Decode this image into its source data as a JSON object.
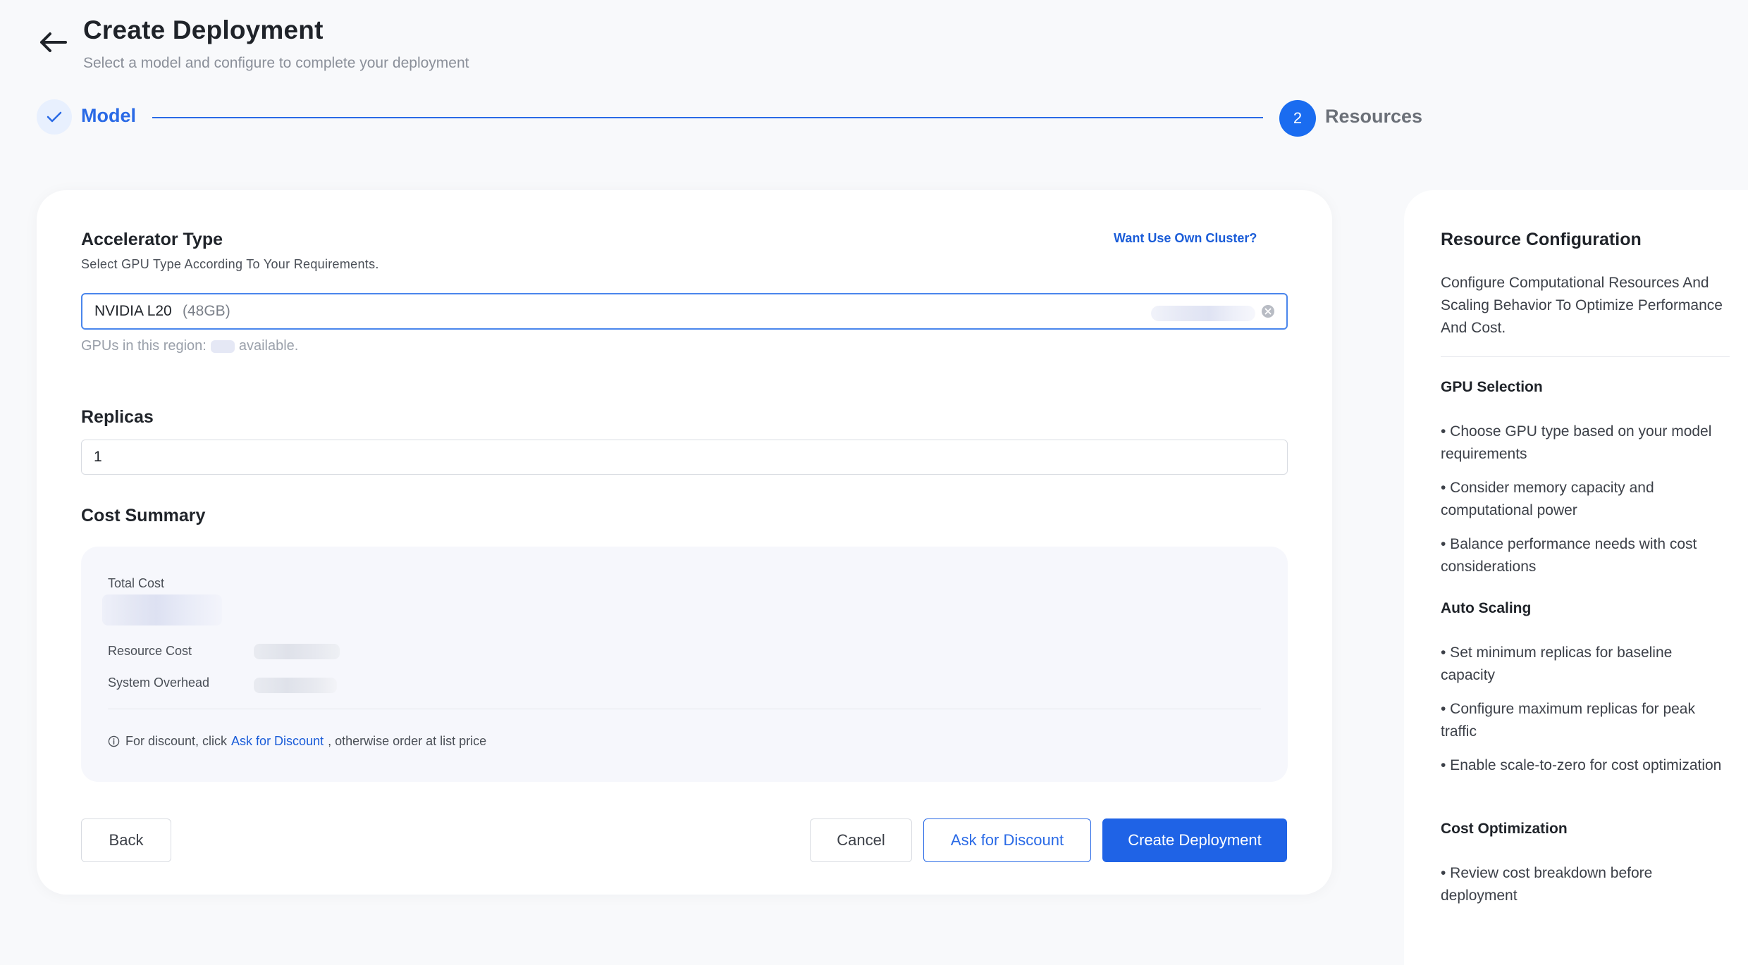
{
  "header": {
    "title": "Create Deployment",
    "subtitle": "Select a model and configure to complete your deployment"
  },
  "stepper": {
    "step1_label": "Model",
    "step2_number": "2",
    "step2_label": "Resources"
  },
  "accelerator": {
    "title": "Accelerator Type",
    "description": "Select GPU Type According To Your Requirements.",
    "own_cluster_link": "Want Use Own Cluster?",
    "selected_gpu": "NVIDIA L20",
    "selected_gpu_memory": "(48GB)",
    "region_note_prefix": "GPUs in this region:",
    "region_note_suffix": "available."
  },
  "replicas": {
    "title": "Replicas",
    "value": "1"
  },
  "cost": {
    "title": "Cost Summary",
    "total_label": "Total Cost",
    "resource_label": "Resource Cost",
    "overhead_label": "System Overhead",
    "note_prefix": "For discount, click",
    "note_link": "Ask for Discount",
    "note_suffix": ", otherwise order at list price"
  },
  "buttons": {
    "back": "Back",
    "cancel": "Cancel",
    "ask_discount": "Ask for Discount",
    "create": "Create Deployment"
  },
  "side_panel": {
    "title": "Resource Configuration",
    "description": "Configure Computational Resources And Scaling Behavior To Optimize Performance And Cost.",
    "sections": [
      {
        "heading": "GPU Selection",
        "bullets": [
          "• Choose GPU type based on your model requirements",
          "• Consider memory capacity and computational power",
          "• Balance performance needs with cost considerations"
        ]
      },
      {
        "heading": "Auto Scaling",
        "bullets": [
          "• Set minimum replicas for baseline capacity",
          "• Configure maximum replicas for peak traffic",
          "• Enable scale-to-zero for cost optimization"
        ]
      },
      {
        "heading": "Cost Optimization",
        "bullets": [
          "• Review cost breakdown before deployment"
        ]
      }
    ]
  },
  "colors": {
    "primary": "#1f63e6",
    "link": "#1a5cd8",
    "background": "#f8f9fb"
  }
}
